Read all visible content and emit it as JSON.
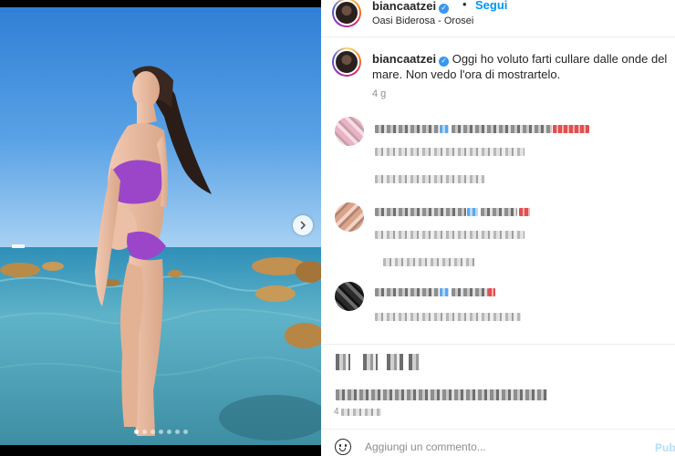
{
  "header": {
    "username": "biancaatzei",
    "separator": "•",
    "follow_label": "Segui",
    "location": "Oasi Biderosa - Orosei"
  },
  "caption": {
    "username": "biancaatzei",
    "text": "Oggi ho voluto farti cullare dalle onde del mare. Non vedo l'ora di mostrartelo.",
    "time": "4 g"
  },
  "footer": {
    "likes_time": "4"
  },
  "add_comment": {
    "placeholder": "Aggiungi un commento...",
    "publish_label": "Pub"
  },
  "carousel": {
    "slide_count": 7,
    "active_index": 0
  },
  "colors": {
    "accent": "#0095f6",
    "verified": "#3897f0",
    "muted": "#8e8e8e"
  },
  "icons": [
    "verified-badge-icon",
    "chevron-right-icon",
    "emoji-icon"
  ]
}
